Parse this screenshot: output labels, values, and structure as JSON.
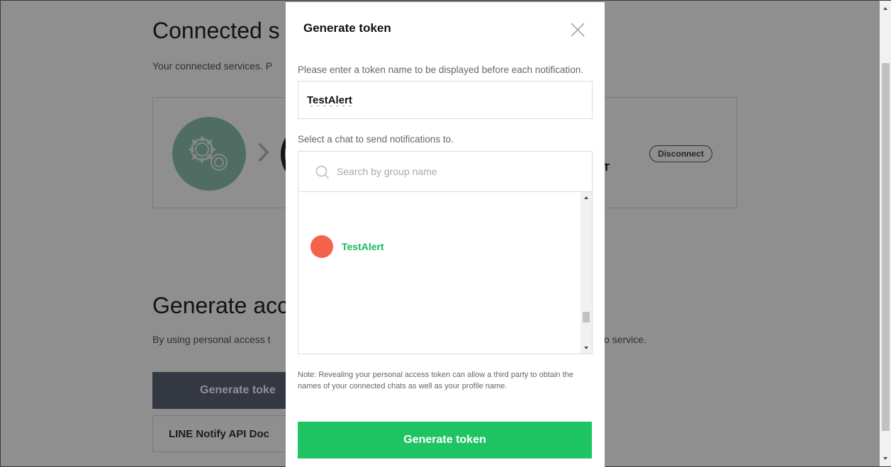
{
  "background": {
    "connected_title": "Connected s",
    "connected_subtitle": "Your connected services. P",
    "service_letter": "T",
    "disconnect_label": "Disconnect",
    "generate_title": "Generate acc",
    "generate_subtitle": "By using personal access t",
    "generate_subtitle_tail": "o service.",
    "generate_button_label": "Generate toke",
    "docs_button_label": "LINE Notify API Doc"
  },
  "modal": {
    "title": "Generate token",
    "close_icon": "close-icon",
    "token_name_label": "Please enter a token name to be displayed before each notification.",
    "token_name_value": "TestAlert",
    "chat_label": "Select a chat to send notifications to.",
    "search_placeholder": "Search by group name",
    "chats": [
      {
        "name": "TestAlert",
        "avatar_color": "#f3634c"
      }
    ],
    "note": "Note: Revealing your personal access token can allow a third party to obtain the names of your connected chats as well as your profile name.",
    "generate_button_label": "Generate token"
  },
  "colors": {
    "accent_green": "#1ec462",
    "chat_name_green": "#19b85a",
    "service_icon_bg": "#8fc2b0",
    "background_button": "#5d6578"
  }
}
